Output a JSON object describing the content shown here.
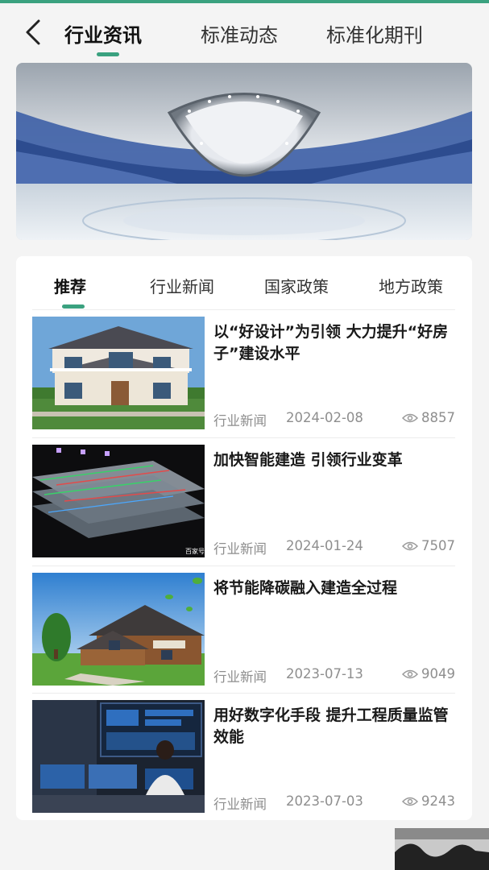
{
  "colors": {
    "accent": "#3aa17f",
    "meta_text": "#8e8e8e"
  },
  "topnav": {
    "back_icon": "chevron-left-icon",
    "tabs": [
      {
        "label": "行业资讯",
        "active": true
      },
      {
        "label": "标准动态",
        "active": false
      },
      {
        "label": "标准化期刊",
        "active": false
      }
    ]
  },
  "banner": {
    "image": "ice-stadium-interior"
  },
  "categories": [
    {
      "label": "推荐",
      "active": true
    },
    {
      "label": "行业新闻",
      "active": false
    },
    {
      "label": "国家政策",
      "active": false
    },
    {
      "label": "地方政策",
      "active": false
    }
  ],
  "news": [
    {
      "title": "以“好设计”为引领 大力提升“好房子”建设水平",
      "category": "行业新闻",
      "date": "2024-02-08",
      "views": "8857",
      "thumb": "villa-house"
    },
    {
      "title": "加快智能建造 引领行业变革",
      "category": "行业新闻",
      "date": "2024-01-24",
      "views": "7507",
      "thumb": "bim-3d-model",
      "watermark": "百家号"
    },
    {
      "title": "将节能降碳融入建造全过程",
      "category": "行业新闻",
      "date": "2023-07-13",
      "views": "9049",
      "thumb": "wooden-house"
    },
    {
      "title": "用好数字化手段 提升工程质量监管效能",
      "category": "行业新闻",
      "date": "2023-07-03",
      "views": "9243",
      "thumb": "control-room"
    }
  ]
}
